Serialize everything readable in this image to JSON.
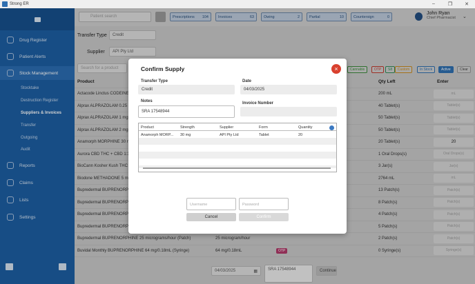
{
  "window": {
    "title": "Strong ER",
    "minimize": "–",
    "maximize": "❐",
    "close": "✕"
  },
  "sidebar": {
    "items": [
      {
        "label": "Drug Register"
      },
      {
        "label": "Patient Alerts"
      },
      {
        "label": "Stock Management"
      },
      {
        "label": "Reports"
      },
      {
        "label": "Claims"
      },
      {
        "label": "Lists"
      },
      {
        "label": "Settings"
      }
    ],
    "sub_items": [
      {
        "label": "Stocktake"
      },
      {
        "label": "Destruction Register"
      },
      {
        "label": "Suppliers & Invoices"
      },
      {
        "label": "Transfer"
      },
      {
        "label": "Outgoing"
      },
      {
        "label": "Audit"
      }
    ],
    "bottom_left_icon": "SI"
  },
  "topbar": {
    "search_placeholder": "Patient search",
    "stats": [
      {
        "label": "Prescriptions",
        "count": "104"
      },
      {
        "label": "Invoices",
        "count": "63"
      },
      {
        "label": "Owing",
        "count": "2"
      },
      {
        "label": "Partial",
        "count": "10"
      },
      {
        "label": "Countersign",
        "count": "0"
      }
    ],
    "user_name": "John Ryan",
    "user_role": "Chief Pharmacist"
  },
  "form": {
    "transfer_type_label": "Transfer Type",
    "transfer_type_value": "Credit",
    "supplier_label": "Supplier",
    "supplier_value": "API Pty Ltd",
    "product_search_placeholder": "Search for a product"
  },
  "filters": [
    {
      "label": "Cannabis",
      "color": "#3a8a3a"
    },
    {
      "label": "OTP",
      "color": "#c0392b"
    },
    {
      "label": "S8",
      "color": "#2e8b57"
    },
    {
      "label": "Custom",
      "color": "#c98a1e"
    },
    {
      "label": "In Stock",
      "color": "#2f6fb0"
    },
    {
      "label": "Active",
      "color": "#2f6fb0"
    },
    {
      "label": "Clear",
      "color": "#666666"
    }
  ],
  "table": {
    "headers": {
      "product": "Product",
      "qty_left": "Qty Left",
      "enter": "Enter"
    },
    "rows": [
      {
        "product": "Actacode Linctus CODEINE",
        "qty": "200 mL",
        "enter": "mL"
      },
      {
        "product": "Alprax ALPRAZOLAM 0.25 m",
        "qty": "40 Tablet(s)",
        "enter": "Tablet(s)"
      },
      {
        "product": "Alprax ALPRAZOLAM 1 mg T",
        "qty": "50 Tablet(s)",
        "enter": "Tablet(s)"
      },
      {
        "product": "Alprax ALPRAZOLAM 2 mg T",
        "qty": "50 Tablet(s)",
        "enter": "Tablet(s)"
      },
      {
        "product": "Anamorph MORPHINE 30 m",
        "qty": "20 Tablet(s)",
        "enter": "20"
      },
      {
        "product": "Aurora CBD THC + CBD 1:3",
        "qty": "1 Oral Drops(s)",
        "enter": "Oral Drops(s)"
      },
      {
        "product": "BioCann Kosher Kush THC",
        "qty": "3 Jar(s)",
        "enter": "Jar(s)"
      },
      {
        "product": "Biodone METHADONE 5 mg",
        "qty": "2764 mL",
        "enter": "mL"
      },
      {
        "product": "Bupredermal BUPRENORPHINE",
        "qty": "13 Patch(s)",
        "enter": "Patch(s)"
      },
      {
        "product": "Bupredermal BUPRENORPHINE",
        "qty": "8 Patch(s)",
        "enter": "Patch(s)"
      },
      {
        "product": "Bupredermal BUPRENORPHINE",
        "qty": "4 Patch(s)",
        "enter": "Patch(s)"
      },
      {
        "product": "Bupredermal BUPRENORPHINE",
        "qty": "5 Patch(s)",
        "enter": "Patch(s)"
      },
      {
        "product": "Bupredermal BUPRENORPHINE 25 micrograms/hour (Patch)",
        "strength": "25 microgram/hour",
        "qty": "2 Patch(s)",
        "enter": "Patch(s)"
      },
      {
        "product": "Buvidal Monthly BUPRENORPHINE 64 mg/0.18mL (Syringe)",
        "strength": "64 mg/0.18mL",
        "badge": "OTP",
        "qty": "0 Syringe(s)",
        "enter": "Syringe(s)"
      }
    ]
  },
  "footer": {
    "date": "04/03/2025",
    "notes": "SRA 17548944",
    "continue_label": "Continue"
  },
  "dialog": {
    "title": "Confirm Supply",
    "transfer_type_label": "Transfer Type",
    "transfer_type_value": "Credit",
    "date_label": "Date",
    "date_value": "04/03/2025",
    "notes_label": "Notes",
    "notes_value": "SRA 17548944",
    "invoice_label": "Invoice Number",
    "invoice_value": "",
    "grid_headers": [
      "Product",
      "Strength",
      "Supplier",
      "Form",
      "Quantity"
    ],
    "grid_row": {
      "product": "Anamorph MORP...",
      "strength": "30 mg",
      "supplier": "API Pty Ltd",
      "form": "Tablet",
      "quantity": "20"
    },
    "username_placeholder": "Username",
    "password_placeholder": "Password",
    "cancel_label": "Cancel",
    "confirm_label": "Confirm"
  }
}
